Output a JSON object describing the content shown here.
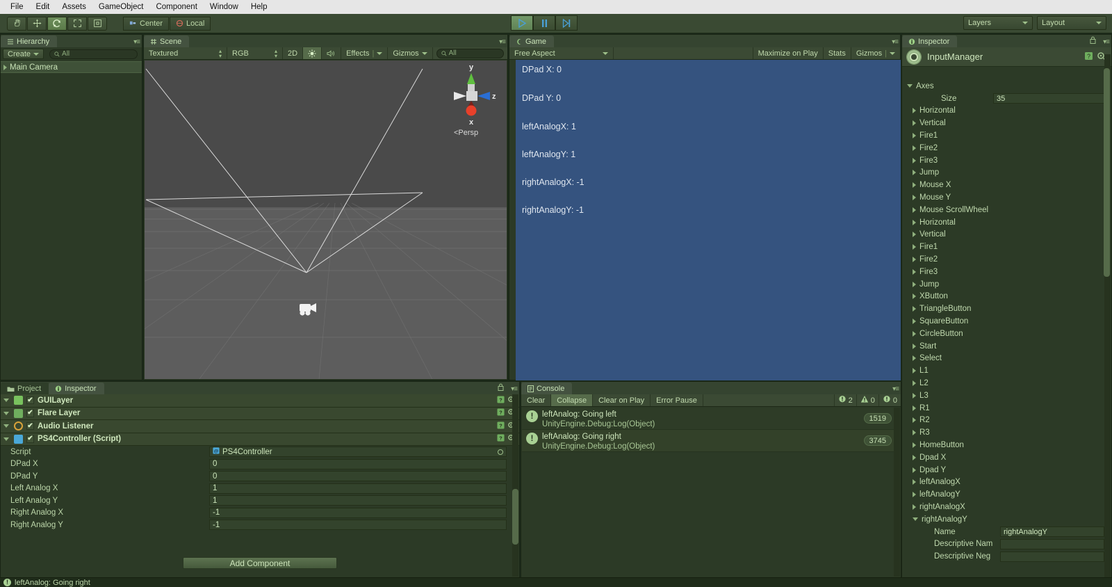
{
  "menubar": {
    "items": [
      "File",
      "Edit",
      "Assets",
      "GameObject",
      "Component",
      "Window",
      "Help"
    ]
  },
  "toolbar": {
    "tools": [
      {
        "name": "hand-tool",
        "glyph": "✋"
      },
      {
        "name": "move-tool",
        "glyph": "✥"
      },
      {
        "name": "rotate-tool",
        "glyph": "↻"
      },
      {
        "name": "scale-tool",
        "glyph": "⤡"
      },
      {
        "name": "rect-tool",
        "glyph": "▣"
      }
    ],
    "pivot_label": "Center",
    "space_label": "Local",
    "play_label": "▶",
    "pause_label": "‖",
    "step_label": "▶|",
    "layers_label": "Layers",
    "layout_label": "Layout"
  },
  "hierarchy": {
    "tab_label": "Hierarchy",
    "create_label": "Create",
    "search_placeholder": "All",
    "items": [
      {
        "label": "Main Camera",
        "selected": true
      }
    ]
  },
  "scene": {
    "tab_label": "Scene",
    "draw_mode": "Textured",
    "color_mode": "RGB",
    "mode_2d": "2D",
    "lighting_icon": "sun-icon",
    "audio_icon": "audio-icon",
    "effects_label": "Effects",
    "gizmos_label": "Gizmos",
    "search_placeholder": "All",
    "gizmo": {
      "y_label": "y",
      "x_label": "x",
      "z_label": "z",
      "perspective_label": "Persp"
    }
  },
  "game": {
    "tab_label": "Game",
    "aspect_label": "Free Aspect",
    "maximize_label": "Maximize on Play",
    "stats_label": "Stats",
    "gizmos_label": "Gizmos",
    "background_color": "#35537f",
    "readouts": [
      "DPad X: 0",
      "DPad Y: 0",
      "leftAnalogX: 1",
      "leftAnalogY: 1",
      "rightAnalogX: -1",
      "rightAnalogY: -1"
    ]
  },
  "inspector_right": {
    "tab_label": "Inspector",
    "asset_title": "InputManager",
    "root_label": "Axes",
    "size_label": "Size",
    "size_value": "35",
    "axes": [
      "Horizontal",
      "Vertical",
      "Fire1",
      "Fire2",
      "Fire3",
      "Jump",
      "Mouse X",
      "Mouse Y",
      "Mouse ScrollWheel",
      "Horizontal",
      "Vertical",
      "Fire1",
      "Fire2",
      "Fire3",
      "Jump",
      "XButton",
      "TriangleButton",
      "SquareButton",
      "CircleButton",
      "Start",
      "Select",
      "L1",
      "L2",
      "L3",
      "R1",
      "R2",
      "R3",
      "HomeButton",
      "Dpad X",
      "Dpad Y",
      "leftAnalogX",
      "leftAnalogY",
      "rightAnalogX"
    ],
    "expanded_axis": {
      "label": "rightAnalogY",
      "fields": [
        {
          "label": "Name",
          "value": "rightAnalogY"
        },
        {
          "label": "Descriptive Nam",
          "value": ""
        },
        {
          "label": "Descriptive Neg",
          "value": ""
        }
      ]
    }
  },
  "inspector_bottom": {
    "tabs": [
      {
        "label": "Project",
        "selected": false
      },
      {
        "label": "Inspector",
        "selected": true
      }
    ],
    "components": [
      {
        "label": "GUILayer",
        "checked": true,
        "icon": "guilayer-icon"
      },
      {
        "label": "Flare Layer",
        "checked": true,
        "icon": "flarelayer-icon"
      },
      {
        "label": "Audio Listener",
        "checked": true,
        "icon": "audiolistener-icon"
      },
      {
        "label": "PS4Controller (Script)",
        "checked": true,
        "icon": "script-icon"
      }
    ],
    "properties": [
      {
        "label": "Script",
        "value": "PS4Controller",
        "type": "object"
      },
      {
        "label": "DPad X",
        "value": "0",
        "type": "number"
      },
      {
        "label": "DPad Y",
        "value": "0",
        "type": "number"
      },
      {
        "label": "Left Analog X",
        "value": "1",
        "type": "number"
      },
      {
        "label": "Left Analog Y",
        "value": "1",
        "type": "number"
      },
      {
        "label": "Right Analog X",
        "value": "-1",
        "type": "number"
      },
      {
        "label": "Right Analog Y",
        "value": "-1",
        "type": "number"
      }
    ],
    "add_component_label": "Add Component"
  },
  "console": {
    "tab_label": "Console",
    "buttons": [
      {
        "label": "Clear",
        "active": false
      },
      {
        "label": "Collapse",
        "active": true
      },
      {
        "label": "Clear on Play",
        "active": false
      },
      {
        "label": "Error Pause",
        "active": false
      }
    ],
    "counters": [
      {
        "icon": "info-icon",
        "value": "2"
      },
      {
        "icon": "warning-icon",
        "value": "0"
      },
      {
        "icon": "error-icon",
        "value": "0"
      }
    ],
    "entries": [
      {
        "message": "leftAnalog: Going left",
        "stack": "UnityEngine.Debug:Log(Object)",
        "count": "1519"
      },
      {
        "message": "leftAnalog: Going right",
        "stack": "UnityEngine.Debug:Log(Object)",
        "count": "3745"
      }
    ]
  },
  "statusbar": {
    "message": "leftAnalog: Going right"
  }
}
